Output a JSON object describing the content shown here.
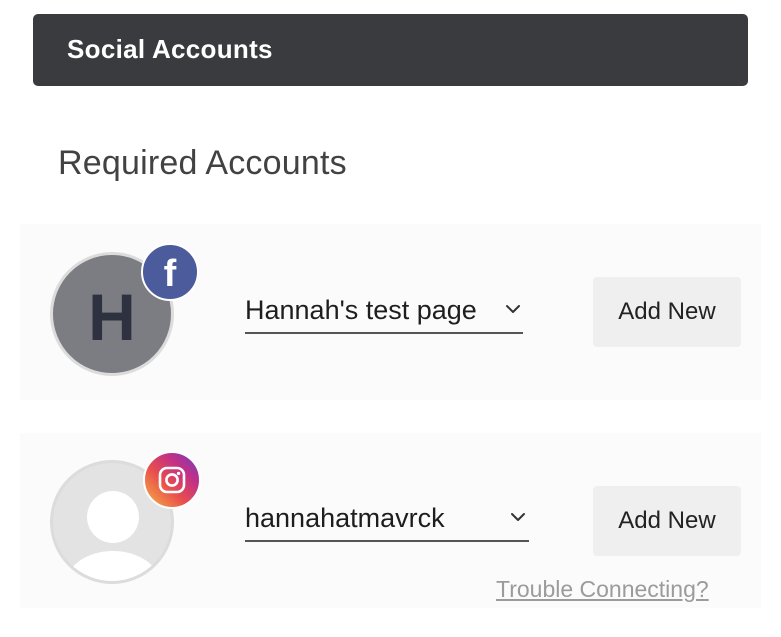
{
  "header": {
    "title": "Social Accounts"
  },
  "section": {
    "title": "Required Accounts"
  },
  "accounts": [
    {
      "platform": "facebook",
      "avatar_letter": "H",
      "badge_icon": "facebook-icon",
      "badge_glyph": "f",
      "selected_account": "Hannah's test page",
      "add_label": "Add New"
    },
    {
      "platform": "instagram",
      "badge_icon": "instagram-icon",
      "selected_account": "hannahatmavrck",
      "add_label": "Add New"
    }
  ],
  "help": {
    "trouble_label": "Trouble Connecting?"
  },
  "colors": {
    "header_bg": "#3a3b3e",
    "facebook_blue": "#4b5b9c",
    "button_bg": "#efefef",
    "row_bg": "#fbfbfb",
    "link_gray": "#9b9b9b"
  }
}
